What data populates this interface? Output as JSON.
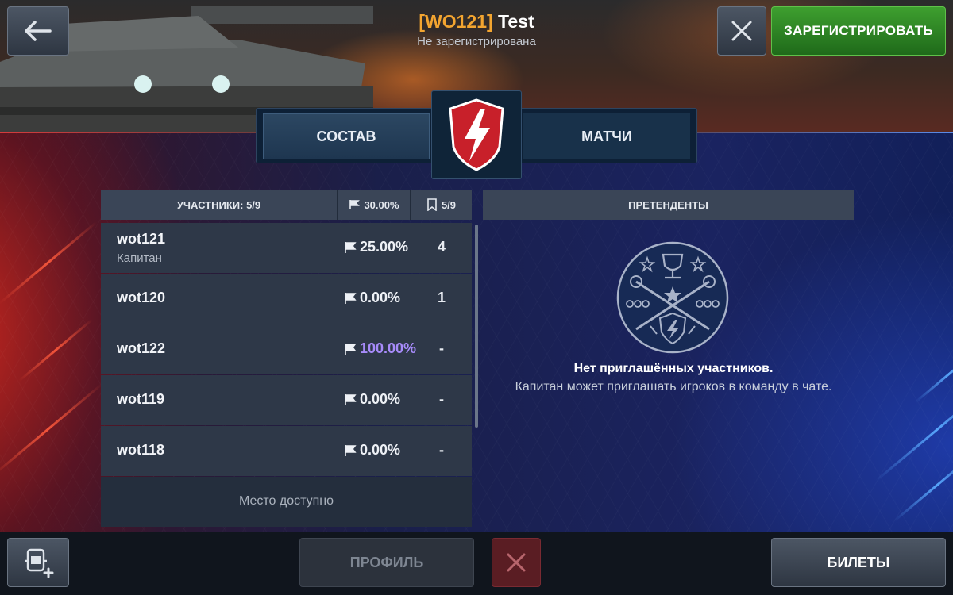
{
  "header": {
    "clan_tag": "[WO121]",
    "team_name": "Test",
    "status": "Не зарегистрирована",
    "register_label": "ЗАРЕГИСТРИРОВАТЬ"
  },
  "tabs": [
    {
      "label": "СОСТАВ",
      "active": true
    },
    {
      "label": "МАТЧИ",
      "active": false
    }
  ],
  "roster": {
    "header": {
      "members_label": "УЧАСТНИКИ: 5/9",
      "winrate": "30.00%",
      "battles": "5/9"
    },
    "rows": [
      {
        "name": "wot121",
        "role": "Капитан",
        "winrate": "25.00%",
        "battles": "4"
      },
      {
        "name": "wot120",
        "role": "",
        "winrate": "0.00%",
        "battles": "1"
      },
      {
        "name": "wot122",
        "role": "",
        "winrate": "100.00%",
        "battles": "-"
      },
      {
        "name": "wot119",
        "role": "",
        "winrate": "0.00%",
        "battles": "-"
      },
      {
        "name": "wot118",
        "role": "",
        "winrate": "0.00%",
        "battles": "-"
      }
    ],
    "free_slot_label": "Место доступно"
  },
  "candidates": {
    "header": "ПРЕТЕНДЕНТЫ",
    "empty_title": "Нет приглашённых участников.",
    "empty_text": "Капитан может приглашать игроков в команду в чате."
  },
  "bottom": {
    "profile_label": "ПРОФИЛЬ",
    "tickets_label": "БИЛЕТЫ"
  },
  "colors": {
    "clan_tag": "#f3a530",
    "register_green": "#2f8a25",
    "high_winrate": "#a78bfa",
    "remove_red": "#5a1d23"
  },
  "icons": {
    "back": "arrow-left-icon",
    "close": "close-icon",
    "emblem": "tournament-lightning-shield-icon",
    "flag": "flag-icon",
    "battles": "bookmark-icon",
    "candidates_emblem": "trophy-crossed-guns-badge-icon",
    "add_friend": "add-player-icon",
    "remove": "close-icon"
  }
}
